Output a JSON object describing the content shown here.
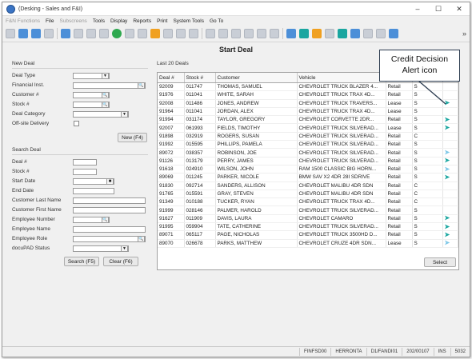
{
  "window": {
    "title": "(Desking - Sales and F&I)",
    "controls": [
      "–",
      "☐",
      "✕"
    ]
  },
  "menus": [
    {
      "label": "F&N Functions",
      "dim": true
    },
    {
      "label": "File",
      "dim": false
    },
    {
      "label": "Subscreens",
      "dim": true
    },
    {
      "label": "Tools",
      "dim": false
    },
    {
      "label": "Display",
      "dim": false
    },
    {
      "label": "Reports",
      "dim": false
    },
    {
      "label": "Print",
      "dim": false
    },
    {
      "label": "System Tools",
      "dim": false
    },
    {
      "label": "Go To",
      "dim": false
    }
  ],
  "page_title": "Start Deal",
  "new_deal": {
    "section_label": "New Deal",
    "fields": [
      "Deal Type",
      "Financial Inst.",
      "Customer #",
      "Stock #",
      "Deal Category",
      "Off-site Delivery"
    ],
    "new_button": "New (F4)"
  },
  "search_deal": {
    "section_label": "Search Deal",
    "fields": [
      "Deal #",
      "Stock #",
      "Start Date",
      "End Date",
      "Customer Last Name",
      "Customer First Name",
      "Employee Number",
      "Employee Name",
      "Employee Role",
      "docuPAD Status"
    ],
    "search_button": "Search (F5)",
    "clear_button": "Clear (F6)"
  },
  "grid": {
    "caption": "Last 20 Deals",
    "columns": [
      "Deal #",
      "Stock #",
      "Customer",
      "Vehicle",
      "",
      "",
      ""
    ],
    "rows": [
      [
        "92009",
        "011747",
        "THOMAS, SAMUEL",
        "CHEVROLET TRUCK BLAZER 4...",
        "Retail",
        "S",
        ""
      ],
      [
        "91976",
        "011041",
        "WHITE, SARAH",
        "CHEVROLET TRUCK TRAX 4D...",
        "Retail",
        "S",
        ""
      ],
      [
        "92008",
        "011486",
        "JONES, ANDREW",
        "CHEVROLET TRUCK TRAVERS...",
        "Lease",
        "S",
        "alert"
      ],
      [
        "91964",
        "011041",
        "JORDAN, ALEX",
        "CHEVROLET TRUCK TRAX 4D...",
        "Lease",
        "S",
        ""
      ],
      [
        "91994",
        "031174",
        "TAYLOR, GREGORY",
        "CHEVROLET CORVETTE 2DR...",
        "Retail",
        "S",
        "alert"
      ],
      [
        "92007",
        "061993",
        "FIELDS, TIMOTHY",
        "CHEVROLET TRUCK SILVERAD...",
        "Lease",
        "S",
        "alert"
      ],
      [
        "91898",
        "032919",
        "ROGERS, SUSAN",
        "CHEVROLET TRUCK SILVERAD...",
        "Retail",
        "C",
        ""
      ],
      [
        "91992",
        "015595",
        "PHILLIPS, PAMELA",
        "CHEVROLET TRUCK SILVERAD...",
        "Retail",
        "S",
        ""
      ],
      [
        "89072",
        "038357",
        "ROBINSON, JOE",
        "CHEVROLET TRUCK SILVERAD...",
        "Retail",
        "S",
        "light"
      ],
      [
        "91126",
        "013179",
        "PERRY, JAMES",
        "CHEVROLET TRUCK SILVERAD...",
        "Retail",
        "S",
        "alert"
      ],
      [
        "91618",
        "024910",
        "WILSON, JOHN",
        "RAM 1500 CLASSIC BIG HORN...",
        "Retail",
        "S",
        "light"
      ],
      [
        "89069",
        "011245",
        "PARKER, NICOLE",
        "BMW SAV X2 4DR 28I SDRIVE",
        "Retail",
        "S",
        "alert"
      ],
      [
        "91830",
        "092714",
        "SANDERS, ALLISON",
        "CHEVROLET MALIBU 4DR SDN",
        "Retail",
        "C",
        ""
      ],
      [
        "91765",
        "015591",
        "GRAY, STEVEN",
        "CHEVROLET MALIBU 4DR SDN",
        "Retail",
        "C",
        ""
      ],
      [
        "91349",
        "010188",
        "TUCKER, RYAN",
        "CHEVROLET TRUCK TRAX 4D...",
        "Retail",
        "C",
        ""
      ],
      [
        "91999",
        "028146",
        "PALMER, HAROLD",
        "CHEVROLET TRUCK SILVERAD...",
        "Retail",
        "S",
        ""
      ],
      [
        "91627",
        "011909",
        "DAVIS, LAURA",
        "CHEVROLET CAMARO",
        "Retail",
        "S",
        "alert"
      ],
      [
        "91995",
        "059904",
        "TATE, CATHERINE",
        "CHEVROLET TRUCK SILVERAD...",
        "Retail",
        "S",
        "alert"
      ],
      [
        "89071",
        "065117",
        "PAGE, NICHOLAS",
        "CHEVROLET TRUCK 3500HD D...",
        "Retail",
        "S",
        "alert"
      ],
      [
        "89070",
        "026678",
        "PARKS, MATTHEW",
        "CHEVROLET CRUZE 4DR SDN...",
        "Lease",
        "S",
        "light"
      ]
    ]
  },
  "select_button": "Select",
  "callout": {
    "line1": "Credit Decision",
    "line2": "Alert icon"
  },
  "status_bar": [
    "FINFSD00",
    "HERRONTA",
    "D1/FANDI01",
    "202/00107",
    "INS",
    "5032"
  ],
  "colors": {
    "alert_icon": "#1aa6a0",
    "alert_icon_light": "#7fc8e8",
    "app_icon": "#3a74c4"
  }
}
